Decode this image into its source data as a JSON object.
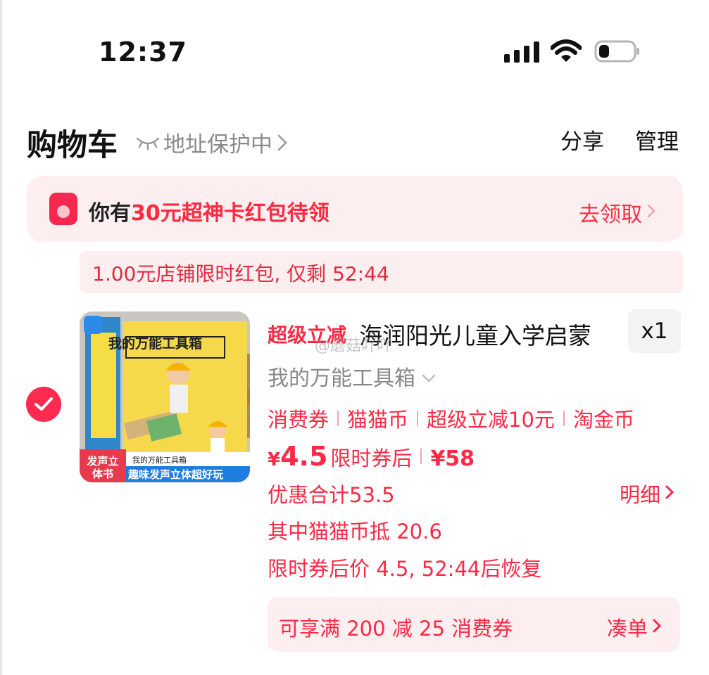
{
  "status_bar": {
    "time": "12:37"
  },
  "header": {
    "title": "购物车",
    "address_protect": "地址保护中",
    "share": "分享",
    "manage": "管理"
  },
  "red_packet": {
    "prefix": "你有",
    "highlight": "30元超神卡红包待领",
    "claim": "去领取"
  },
  "shop_packet": {
    "text": "1.00元店铺限时红包, 仅剩 52:44"
  },
  "product": {
    "super_tag": "超级立减",
    "title": "海润阳光儿童入学启蒙",
    "watermark": "@蘑菇吖吖",
    "quantity": "x1",
    "spec": "我的万能工具箱",
    "tags": [
      "消费券",
      "猫猫币",
      "超级立减10元",
      "淘金币"
    ],
    "price_symbol": "¥",
    "price": "4.5",
    "price_note": "限时券后",
    "original_price": "¥58",
    "discount_total": "优惠合计53.5",
    "detail_link": "明细",
    "coin_deduct": "其中猫猫币抵 20.6",
    "restore_note": "限时券后价 4.5, 52:44后恢复",
    "image": {
      "book_title": "我的万能工具箱",
      "badge": "发声立体书",
      "slogan_small": "我的万能工具箱",
      "slogan": "趣味发声立体超好玩"
    }
  },
  "coupon_bar": {
    "text": "可享满 200 减 25 消费券",
    "action": "凑单"
  },
  "colors": {
    "accent_red": "#ff2945",
    "banner_bg": "#fdeff0",
    "checkbox": "#ff2a50"
  }
}
